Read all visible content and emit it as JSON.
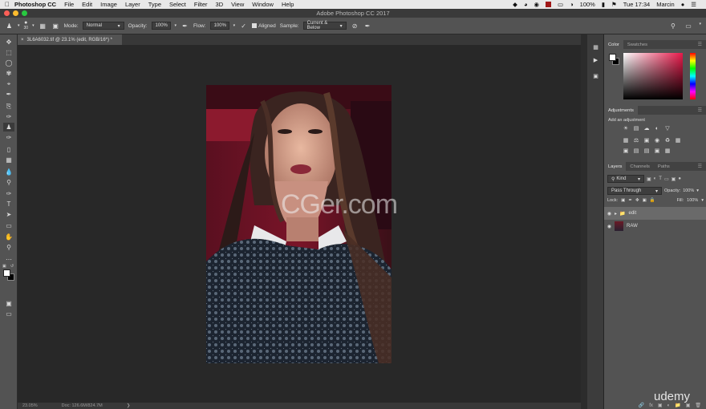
{
  "menubar": {
    "app_name": "Photoshop CC",
    "items": [
      "File",
      "Edit",
      "Image",
      "Layer",
      "Type",
      "Select",
      "Filter",
      "3D",
      "View",
      "Window",
      "Help"
    ],
    "battery": "100%",
    "clock": "Tue 17:34",
    "user": "Marcin"
  },
  "window": {
    "title": "Adobe Photoshop CC 2017"
  },
  "options": {
    "brush_size": "30",
    "mode_label": "Mode:",
    "mode_value": "Normal",
    "opacity_label": "Opacity:",
    "opacity_value": "100%",
    "flow_label": "Flow:",
    "flow_value": "100%",
    "aligned_label": "Aligned",
    "sample_label": "Sample:",
    "sample_value": "Current & Below"
  },
  "document": {
    "tab_title": "3L6A6032.tif @ 23.1% (edit, RGB/16*) *",
    "zoom": "23.05%",
    "doc_info": "Doc: 126.6M/824.7M"
  },
  "watermark": "CGer.com",
  "panels": {
    "color_tabs": [
      "Color",
      "Swatches"
    ],
    "adjustments_title": "Adjustments",
    "add_adjustment": "Add an adjustment",
    "layers_tabs": [
      "Layers",
      "Channels",
      "Paths"
    ],
    "filter_kind": "Kind",
    "blend_mode": "Pass Through",
    "opacity_label": "Opacity:",
    "opacity_value": "100%",
    "lock_label": "Lock:",
    "fill_label": "Fill:",
    "fill_value": "100%",
    "layers": [
      {
        "name": "edit"
      },
      {
        "name": "RAW"
      }
    ]
  },
  "branding": "udemy"
}
